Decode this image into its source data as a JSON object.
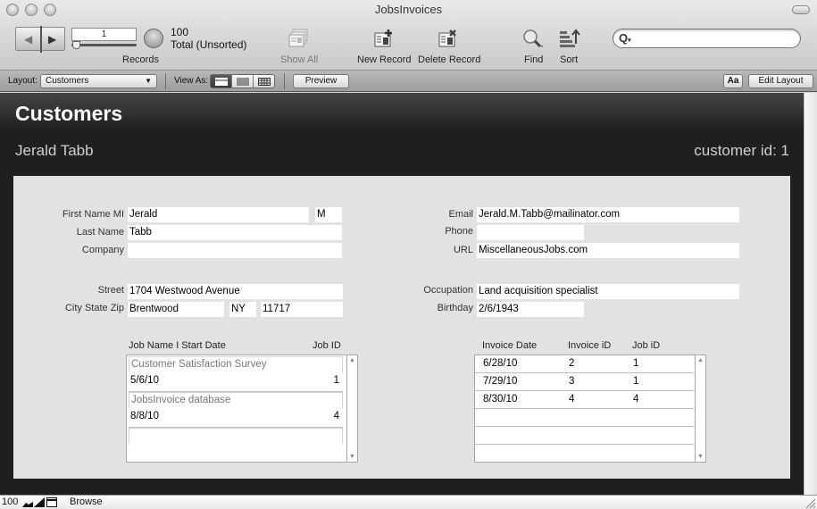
{
  "window": {
    "title": "JobsInvoices"
  },
  "toolbar": {
    "record_number": "1",
    "record_progress_fraction": 0.01,
    "total_count": "100",
    "total_label": "Total (Unsorted)",
    "records_label": "Records",
    "show_all_label": "Show All",
    "new_record_label": "New Record",
    "delete_record_label": "Delete Record",
    "find_label": "Find",
    "sort_label": "Sort",
    "search_value": "",
    "search_placeholder": ""
  },
  "layoutbar": {
    "layout_label": "Layout:",
    "layout_value": "Customers",
    "view_as_label": "View As:",
    "view_modes": [
      "form",
      "list",
      "table"
    ],
    "active_view": "form",
    "preview_label": "Preview",
    "text_format_label": "Aa",
    "edit_layout_label": "Edit Layout"
  },
  "header": {
    "title": "Customers",
    "customer_name": "Jerald Tabb",
    "customer_id": "customer id: 1"
  },
  "form": {
    "first_name_label": "First Name MI",
    "first_name": "Jerald",
    "middle_initial": "M",
    "last_name_label": "Last Name",
    "last_name": "Tabb",
    "company_label": "Company",
    "company": "",
    "street_label": "Street",
    "street": "1704 Westwood Avenue",
    "csz_label": "City State Zip",
    "city": "Brentwood",
    "state": "NY",
    "zip": "11717",
    "email_label": "Email",
    "email": "Jerald.M.Tabb@mailinator.com",
    "phone_label": "Phone",
    "phone": "",
    "url_label": "URL",
    "url": "MiscellaneousJobs.com",
    "occupation_label": "Occupation",
    "occupation": "Land acquisition specialist",
    "birthday_label": "Birthday",
    "birthday": "2/6/1943"
  },
  "jobs_portal": {
    "header_name": "Job Name I Start Date",
    "header_id": "Job ID",
    "rows": [
      {
        "name": "Customer Satisfaction Survey",
        "start_date": "5/6/10",
        "job_id": "1"
      },
      {
        "name": "JobsInvoice database",
        "start_date": "8/8/10",
        "job_id": "4"
      }
    ]
  },
  "invoices_portal": {
    "headers": [
      "Invoice Date",
      "Invoice iD",
      "Job iD"
    ],
    "rows": [
      [
        "6/28/10",
        "2",
        "1"
      ],
      [
        "7/29/10",
        "3",
        "1"
      ],
      [
        "8/30/10",
        "4",
        "4"
      ]
    ]
  },
  "statusbar": {
    "zoom": "100",
    "mode": "Browse"
  }
}
